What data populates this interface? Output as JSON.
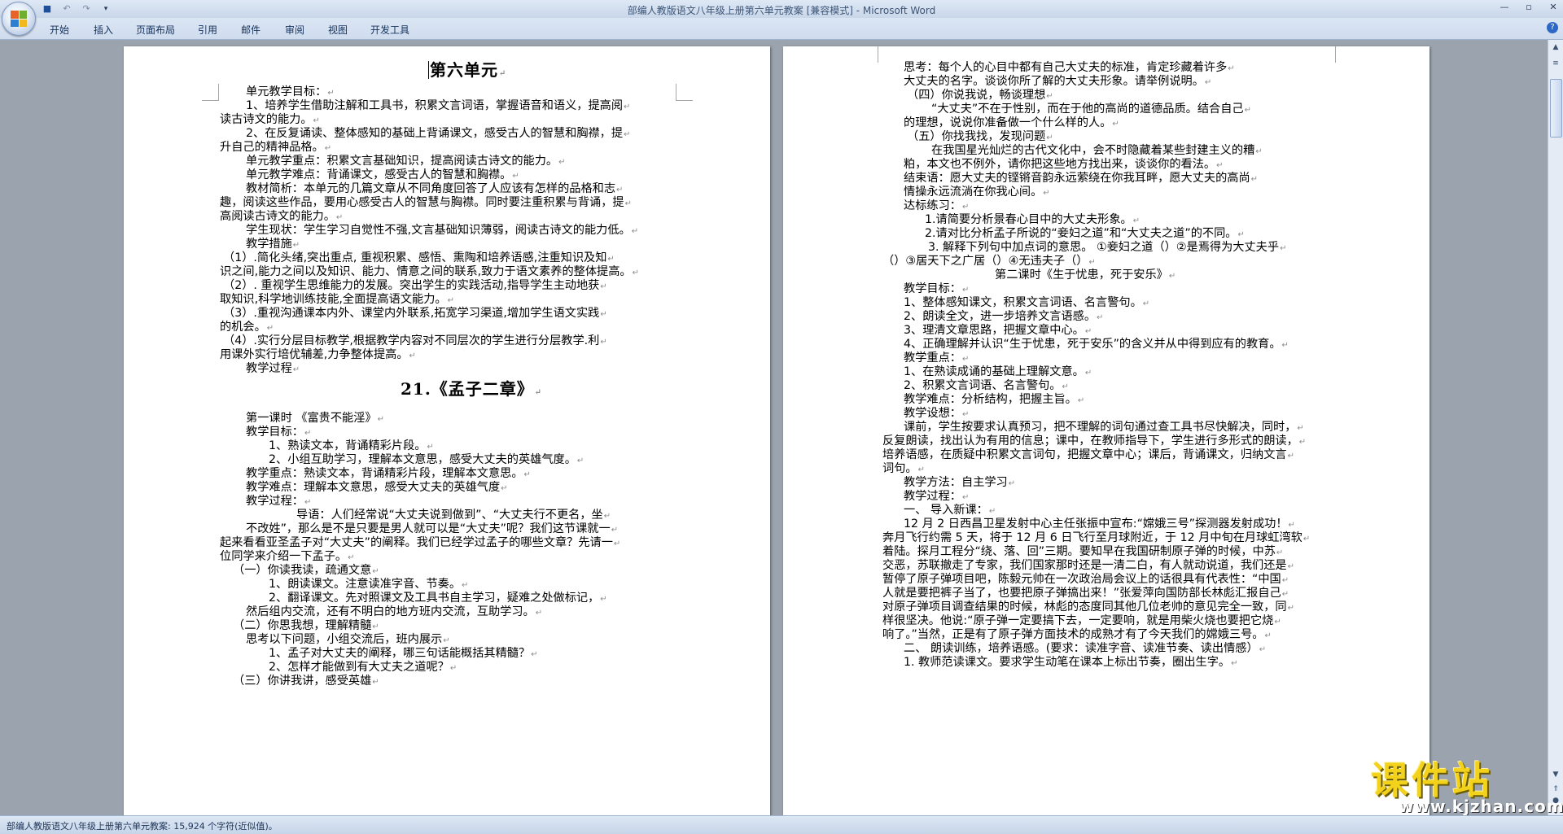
{
  "window": {
    "title": "部编人教版语文八年级上册第六单元教案 [兼容模式] - Microsoft Word"
  },
  "ribbon": {
    "tabs": [
      "开始",
      "插入",
      "页面布局",
      "引用",
      "邮件",
      "审阅",
      "视图",
      "开发工具"
    ]
  },
  "icons": {
    "office_button": "office-logo-icon",
    "save": "save-icon",
    "undo": "undo-icon",
    "redo": "redo-icon",
    "qat_more": "dropdown-icon",
    "help": "help-icon"
  },
  "status": {
    "text": "部编人教版语文八年级上册第六单元教案: 15,924 个字符(近似值)。"
  },
  "page1": {
    "lines": [
      "第六单元",
      "单元教学目标：",
      "1、培养学生借助注解和工具书，积累文言词语，掌握语音和语义，提高阅",
      "读古诗文的能力。",
      "2、在反复诵读、整体感知的基础上背诵课文，感受古人的智慧和胸襟，提",
      "升自己的精神品格。",
      "单元教学重点：积累文言基础知识，提高阅读古诗文的能力。",
      "单元教学难点：背诵课文，感受古人的智慧和胸襟。",
      "教材简析：本单元的几篇文章从不同角度回答了人应该有怎样的品格和志",
      "趣，阅读这些作品，要用心感受古人的智慧与胸襟。同时要注重积累与背诵，提",
      "高阅读古诗文的能力。",
      "学生现状：学生学习自觉性不强,文言基础知识薄弱，阅读古诗文的能力低。",
      "教学措施",
      "（1）.简化头绪,突出重点, 重视积累、感悟、熏陶和培养语感,注重知识及知",
      "识之间,能力之间以及知识、能力、情意之间的联系,致力于语文素养的整体提高。",
      "（2）. 重视学生思维能力的发展。突出学生的实践活动,指导学生主动地获",
      "取知识,科学地训练技能,全面提高语文能力。",
      "（3）.重视沟通课本内外、课堂内外联系,拓宽学习渠道,增加学生语文实践",
      "的机会。",
      "（4）.实行分层目标教学,根据教学内容对不同层次的学生进行分层教学.利",
      "用课外实行培优辅差,力争整体提高。",
      "教学过程",
      "21.《孟子二章》",
      "第一课时 《富贵不能淫》",
      "教学目标：",
      "1、熟读文本，背诵精彩片段。",
      "2、小组互助学习，理解本文意思，感受大丈夫的英雄气度。",
      "教学重点：熟读文本，背诵精彩片段，理解本文意思。",
      "教学难点：理解本文意思，感受大丈夫的英雄气度",
      "教学过程：",
      "导语：人们经常说“大丈夫说到做到”、“大丈夫行不更名，坐",
      "不改姓”，那么是不是只要是男人就可以是“大丈夫”呢？我们这节课就一",
      "起来看看亚圣孟子对“大丈夫”的阐释。我们已经学过孟子的哪些文章？先请一",
      "位同学来介绍一下孟子。",
      "（一）你读我读，疏通文意",
      "1、朗读课文。注意读准字音、节奏。",
      "2、翻译课文。先对照课文及工具书自主学习，疑难之处做标记，",
      "然后组内交流，还有不明白的地方班内交流，互助学习。",
      "（二）你思我想，理解精髓",
      "思考以下问题，小组交流后，班内展示",
      "1、孟子对大丈夫的阐释，哪三句话能概括其精髓？",
      "2、怎样才能做到有大丈夫之道呢？",
      "（三）你讲我讲，感受英雄"
    ]
  },
  "page2": {
    "lines": [
      "思考：每个人的心目中都有自己大丈夫的标准，肯定珍藏着许多",
      "大丈夫的名字。谈谈你所了解的大丈夫形象。请举例说明。",
      "（四）你说我说，畅谈理想",
      "“大丈夫”不在于性别，而在于他的高尚的道德品质。结合自己",
      "的理想，说说你准备做一个什么样的人。",
      "（五）你找我找，发现问题",
      "在我国星光灿烂的古代文化中，会不时隐藏着某些封建主义的糟",
      "粕，本文也不例外，请你把这些地方找出来，谈谈你的看法。",
      "结束语：愿大丈夫的铿锵音韵永远萦绕在你我耳畔，愿大丈夫的高尚",
      "情操永远流淌在你我心间。",
      "达标练习：",
      "1.请简要分析景春心目中的大丈夫形象。",
      "2.请对比分析孟子所说的“妾妇之道”和“大丈夫之道”的不同。",
      "3. 解释下列句中加点词的意思。 ①妾妇之道（）②是焉得为大丈夫乎",
      "（）③居天下之广居（）④无违夫子（）",
      "第二课时《生于忧患，死于安乐》",
      "教学目标：",
      "1、整体感知课文，积累文言词语、名言警句。",
      "2、朗读全文，进一步培养文言语感。",
      "3、理清文章思路，把握文章中心。",
      "4、正确理解并认识“生于忧患，死于安乐”的含义并从中得到应有的教育。",
      "教学重点：",
      "1、在熟读成诵的基础上理解文意。",
      "2、积累文言词语、名言警句。",
      "教学难点：分析结构，把握主旨。",
      "教学设想：",
      "课前，学生按要求认真预习，把不理解的词句通过查工具书尽快解决，同时，",
      "反复朗读，找出认为有用的信息；课中，在教师指导下，学生进行多形式的朗读，",
      "培养语感，在质疑中积累文言词句，把握文章中心；课后，背诵课文，归纳文言",
      "词句。",
      "教学方法：自主学习",
      "教学过程：",
      "一、 导入新课：",
      "12 月 2 日西昌卫星发射中心主任张振中宣布:“嫦娥三号”探测器发射成功！",
      "奔月飞行约需 5 天，将于 12 月 6 日飞行至月球附近，于 12 月中旬在月球虹湾软",
      "着陆。探月工程分“绕、落、回”三期。要知早在我国研制原子弹的时候，中苏",
      "交恶，苏联撤走了专家，我们国家那时还是一清二白，有人就动说道，我们还是",
      "暂停了原子弹项目吧，陈毅元帅在一次政治局会议上的话很具有代表性：“中国",
      "人就是要把裤子当了，也要把原子弹搞出来！”张爱萍向国防部长林彪汇报自己",
      "对原子弹项目调查结果的时候，林彪的态度同其他几位老帅的意见完全一致，同",
      "样很坚决。他说:“原子弹一定要搞下去，一定要响，就是用柴火烧也要把它烧",
      "响了。”当然，正是有了原子弹方面技术的成熟才有了今天我们的嫦娥三号。",
      "二、 朗读训练，培养语感。(要求：读准字音、读准节奏、读出情感）",
      "1. 教师范读课文。要求学生动笔在课本上标出节奏，圈出生字。"
    ]
  },
  "watermark": {
    "text": "课件站",
    "url": "www.kjzhan.com"
  }
}
